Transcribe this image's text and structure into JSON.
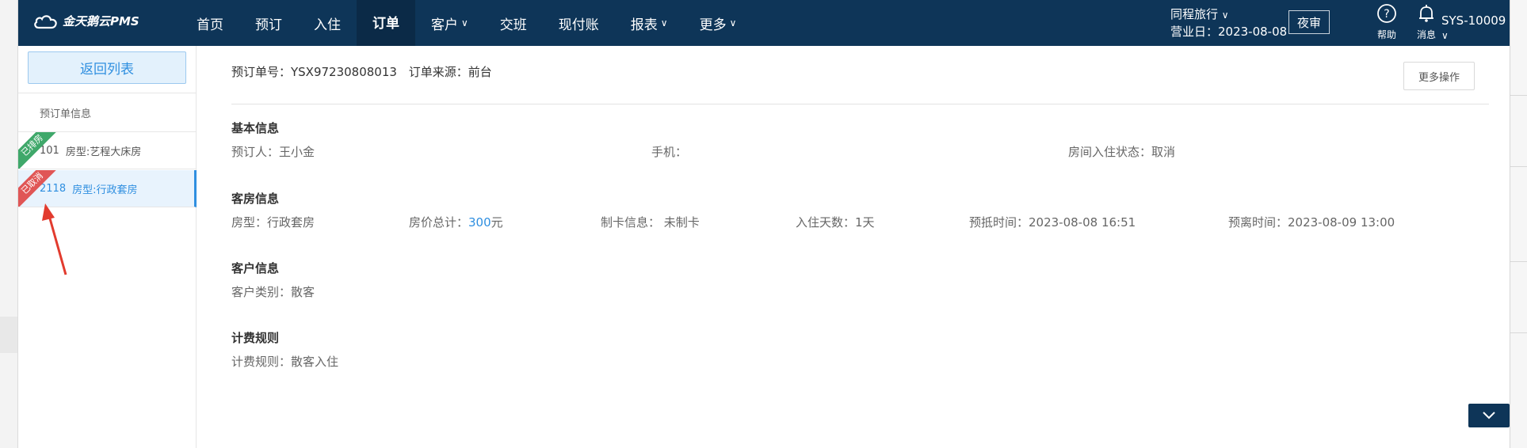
{
  "topbar": {
    "logo_text": "金天鹅云PMS",
    "nav": [
      {
        "label": "首页",
        "caret": ""
      },
      {
        "label": "预订",
        "caret": ""
      },
      {
        "label": "入住",
        "caret": ""
      },
      {
        "label": "订单",
        "caret": ""
      },
      {
        "label": "客户",
        "caret": "∨"
      },
      {
        "label": "交班",
        "caret": ""
      },
      {
        "label": "现付账",
        "caret": ""
      },
      {
        "label": "报表",
        "caret": "∨"
      },
      {
        "label": "更多",
        "caret": "∨"
      }
    ],
    "hotel_name": "同程旅行",
    "business_date": "营业日：2023-08-08",
    "night_audit": "夜审",
    "help_label": "帮助",
    "messages_label": "消息",
    "user": "SYS-10009"
  },
  "sidebar": {
    "back_label": "返回列表",
    "section_label": "预订单信息",
    "rooms": [
      {
        "ribbon": "已排房",
        "number": "101",
        "type": "房型:艺程大床房"
      },
      {
        "ribbon": "已取消",
        "number": "2118",
        "type": "房型:行政套房"
      }
    ]
  },
  "order": {
    "number_label": "预订单号：YSX97230808013",
    "source_label": "订单来源：前台",
    "more_actions": "更多操作"
  },
  "basic_info": {
    "title": "基本信息",
    "booker": "预订人：王小金",
    "phone": "手机：",
    "checkin_status": "房间入住状态：取消"
  },
  "room_info": {
    "title": "客房信息",
    "room_type": "房型：行政套房",
    "price_label": "房价总计：",
    "price_value": "300",
    "price_unit": "元",
    "card_info": "制卡信息：   未制卡",
    "nights": "入住天数：1天",
    "arrival": "预抵时间：2023-08-08 16:51",
    "departure": "预离时间：2023-08-09 13:00"
  },
  "customer_info": {
    "title": "客户信息",
    "category": "客户类别：散客"
  },
  "billing": {
    "title": "计费规则",
    "rule": "计费规则：散客入住"
  },
  "colors": {
    "topbar": "#0e3558",
    "accent": "#2f8fe0",
    "ribbon_booked": "#3fa86a",
    "ribbon_cancelled": "#e05656"
  }
}
